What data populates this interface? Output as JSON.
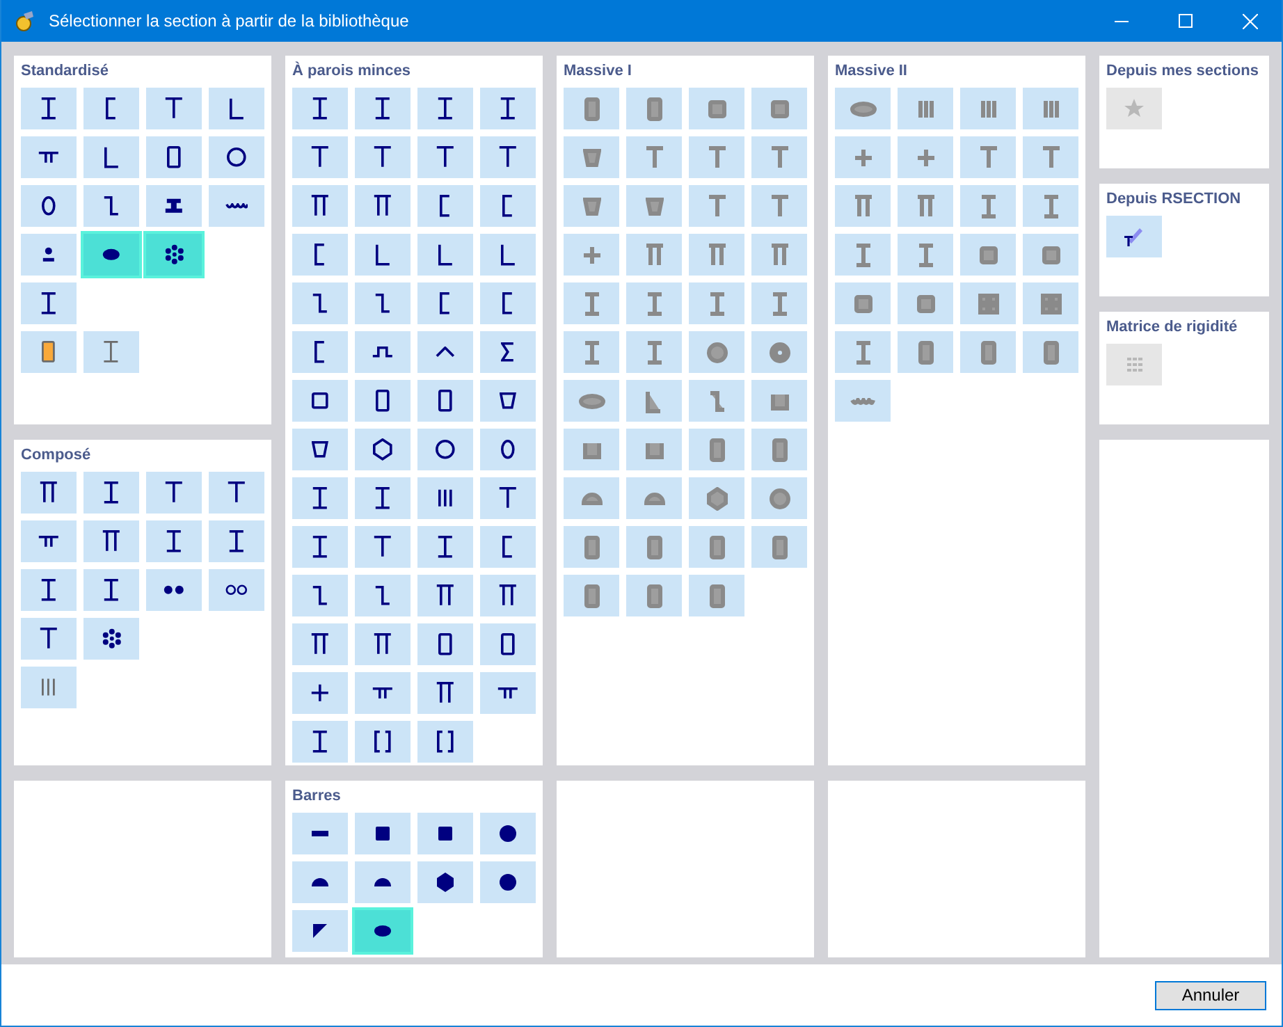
{
  "window": {
    "title": "Sélectionner la section à partir de la bibliothèque"
  },
  "panels": [
    {
      "title": "Standardisé",
      "rows": [
        [
          {
            "selected": false
          },
          {
            "selected": false
          },
          {
            "selected": false
          },
          {
            "selected": false
          }
        ],
        [
          {
            "selected": false
          },
          {
            "selected": false
          },
          {
            "selected": false
          },
          {
            "selected": false
          }
        ],
        [
          {
            "selected": false
          },
          {
            "selected": false
          },
          {
            "selected": false
          },
          {
            "selected": false
          }
        ],
        [
          {
            "selected": false
          },
          {
            "selected": true
          },
          {
            "selected": true
          }
        ],
        [
          {
            "selected": false
          }
        ],
        [
          {
            "selected": false
          },
          {
            "selected": false
          }
        ]
      ]
    },
    {
      "title": "À parois minces",
      "rows": [
        [
          {
            "selected": false
          },
          {
            "selected": false
          },
          {
            "selected": false
          },
          {
            "selected": false
          }
        ],
        [
          {
            "selected": false
          },
          {
            "selected": false
          },
          {
            "selected": false
          },
          {
            "selected": false
          }
        ],
        [
          {
            "selected": false
          },
          {
            "selected": false
          },
          {
            "selected": false
          },
          {
            "selected": false
          }
        ],
        [
          {
            "selected": false
          },
          {
            "selected": false
          },
          {
            "selected": false
          },
          {
            "selected": false
          }
        ],
        [
          {
            "selected": false
          },
          {
            "selected": false
          },
          {
            "selected": false
          },
          {
            "selected": false
          }
        ],
        [
          {
            "selected": false
          },
          {
            "selected": false
          },
          {
            "selected": false
          },
          {
            "selected": false
          }
        ],
        [
          {
            "selected": false
          },
          {
            "selected": false
          },
          {
            "selected": false
          },
          {
            "selected": false
          }
        ],
        [
          {
            "selected": false
          },
          {
            "selected": false
          },
          {
            "selected": false
          },
          {
            "selected": false
          }
        ],
        [
          {
            "selected": false
          },
          {
            "selected": false
          },
          {
            "selected": false
          },
          {
            "selected": false
          }
        ],
        [
          {
            "selected": false
          },
          {
            "selected": false
          },
          {
            "selected": false
          },
          {
            "selected": false
          }
        ],
        [
          {
            "selected": false
          },
          {
            "selected": false
          },
          {
            "selected": false
          },
          {
            "selected": false
          }
        ],
        [
          {
            "selected": false
          },
          {
            "selected": false
          },
          {
            "selected": false
          },
          {
            "selected": false
          }
        ],
        [
          {
            "selected": false
          },
          {
            "selected": false
          },
          {
            "selected": false
          },
          {
            "selected": false
          }
        ],
        [
          {
            "selected": false
          },
          {
            "selected": false
          },
          {
            "selected": false
          }
        ]
      ]
    },
    {
      "title": "Massive I",
      "rows": [
        [
          {
            "selected": false
          },
          {
            "selected": false
          },
          {
            "selected": false
          },
          {
            "selected": false
          }
        ],
        [
          {
            "selected": false
          },
          {
            "selected": false
          },
          {
            "selected": false
          },
          {
            "selected": false
          }
        ],
        [
          {
            "selected": false
          },
          {
            "selected": false
          },
          {
            "selected": false
          },
          {
            "selected": false
          }
        ],
        [
          {
            "selected": false
          },
          {
            "selected": false
          },
          {
            "selected": false
          },
          {
            "selected": false
          }
        ],
        [
          {
            "selected": false
          },
          {
            "selected": false
          },
          {
            "selected": false
          },
          {
            "selected": false
          }
        ],
        [
          {
            "selected": false
          },
          {
            "selected": false
          },
          {
            "selected": false
          },
          {
            "selected": false
          }
        ],
        [
          {
            "selected": false
          },
          {
            "selected": false
          },
          {
            "selected": false
          },
          {
            "selected": false
          }
        ],
        [
          {
            "selected": false
          },
          {
            "selected": false
          },
          {
            "selected": false
          },
          {
            "selected": false
          }
        ],
        [
          {
            "selected": false
          },
          {
            "selected": false
          },
          {
            "selected": false
          },
          {
            "selected": false
          }
        ],
        [
          {
            "selected": false
          },
          {
            "selected": false
          },
          {
            "selected": false
          },
          {
            "selected": false
          }
        ],
        [
          {
            "selected": false
          },
          {
            "selected": false
          },
          {
            "selected": false
          }
        ]
      ]
    },
    {
      "title": "Massive II",
      "rows": [
        [
          {
            "selected": false
          },
          {
            "selected": false
          },
          {
            "selected": false
          },
          {
            "selected": false
          }
        ],
        [
          {
            "selected": false
          },
          {
            "selected": false
          },
          {
            "selected": false
          },
          {
            "selected": false
          }
        ],
        [
          {
            "selected": false
          },
          {
            "selected": false
          },
          {
            "selected": false
          },
          {
            "selected": false
          }
        ],
        [
          {
            "selected": false
          },
          {
            "selected": false
          },
          {
            "selected": false
          },
          {
            "selected": false
          }
        ],
        [
          {
            "selected": false
          },
          {
            "selected": false
          },
          {
            "selected": false
          },
          {
            "selected": false
          }
        ],
        [
          {
            "selected": false
          },
          {
            "selected": false
          },
          {
            "selected": false
          },
          {
            "selected": false
          }
        ],
        [
          {
            "selected": false
          }
        ]
      ]
    },
    {
      "title": "Depuis mes sections",
      "rows": [
        [
          {
            "selected": false,
            "disabled": true
          }
        ]
      ]
    },
    {
      "title": "Depuis RSECTION",
      "rows": [
        [
          {
            "selected": false,
            "disabled": false
          }
        ]
      ]
    },
    {
      "title": "Matrice de rigidité",
      "rows": [
        [
          {
            "selected": false,
            "disabled": true
          }
        ]
      ]
    },
    {
      "title": "Composé",
      "rows": [
        [
          {
            "selected": false
          },
          {
            "selected": false
          },
          {
            "selected": false
          },
          {
            "selected": false
          }
        ],
        [
          {
            "selected": false
          },
          {
            "selected": false
          },
          {
            "selected": false
          },
          {
            "selected": false
          }
        ],
        [
          {
            "selected": false
          },
          {
            "selected": false
          },
          {
            "selected": false
          },
          {
            "selected": false
          }
        ],
        [
          {
            "selected": false
          },
          {
            "selected": false
          }
        ],
        [
          {
            "selected": false
          }
        ]
      ]
    },
    {
      "title": "Barres",
      "rows": [
        [
          {
            "selected": false
          },
          {
            "selected": false
          },
          {
            "selected": false
          },
          {
            "selected": false
          }
        ],
        [
          {
            "selected": false
          },
          {
            "selected": false
          },
          {
            "selected": false
          },
          {
            "selected": false
          }
        ],
        [
          {
            "selected": false
          },
          {
            "selected": true
          }
        ]
      ]
    }
  ],
  "buttons": [
    "Annuler"
  ]
}
